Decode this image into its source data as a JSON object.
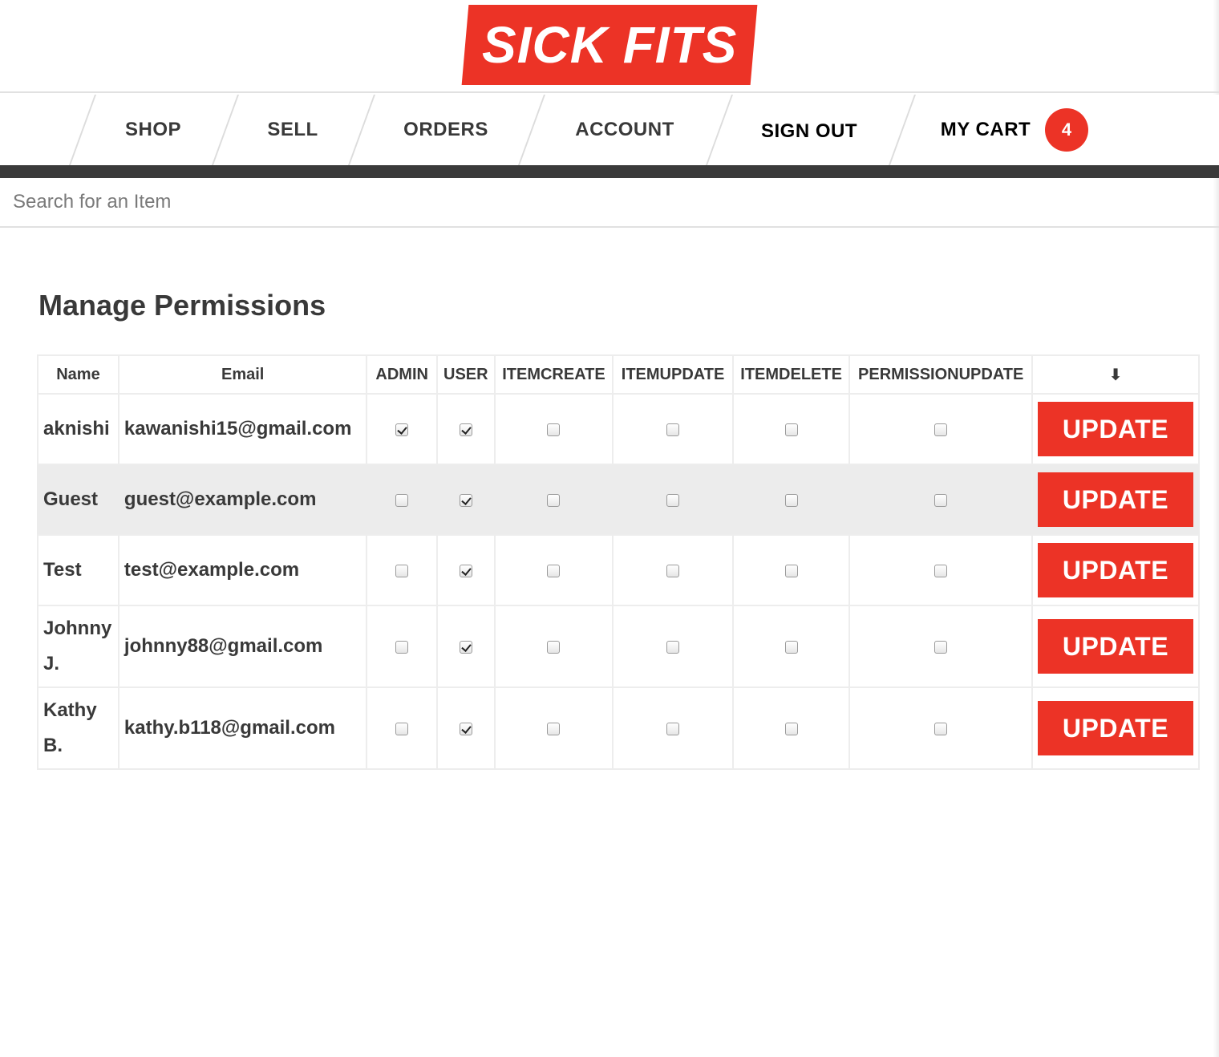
{
  "logo": {
    "text": "SICK FITS"
  },
  "nav": {
    "items": [
      "SHOP",
      "SELL",
      "ORDERS",
      "ACCOUNT",
      "SIGN OUT"
    ],
    "cart_label": "MY CART",
    "cart_count": "4"
  },
  "search": {
    "placeholder": "Search for an Item"
  },
  "permissions": {
    "title": "Manage Permissions",
    "columns": [
      "Name",
      "Email",
      "ADMIN",
      "USER",
      "ITEMCREATE",
      "ITEMUPDATE",
      "ITEMDELETE",
      "PERMISSIONUPDATE"
    ],
    "action_header_icon": "arrow-down-icon",
    "action_header_glyph": "⬇",
    "update_label": "UPDATE",
    "users": [
      {
        "name": "aknishi",
        "email": "kawanishi15@gmail.com",
        "perms": [
          true,
          true,
          false,
          false,
          false,
          false
        ]
      },
      {
        "name": "Guest",
        "email": "guest@example.com",
        "perms": [
          false,
          true,
          false,
          false,
          false,
          false
        ]
      },
      {
        "name": "Test",
        "email": "test@example.com",
        "perms": [
          false,
          true,
          false,
          false,
          false,
          false
        ]
      },
      {
        "name": "Johnny J.",
        "email": "johnny88@gmail.com",
        "perms": [
          false,
          true,
          false,
          false,
          false,
          false
        ]
      },
      {
        "name": "Kathy B.",
        "email": "kathy.b118@gmail.com",
        "perms": [
          false,
          true,
          false,
          false,
          false,
          false
        ]
      }
    ]
  },
  "colors": {
    "brand_red": "#ec3326",
    "dark_bar": "#3a3a3a",
    "text": "#393939",
    "row_alt": "#ececec",
    "border": "#ededed"
  }
}
